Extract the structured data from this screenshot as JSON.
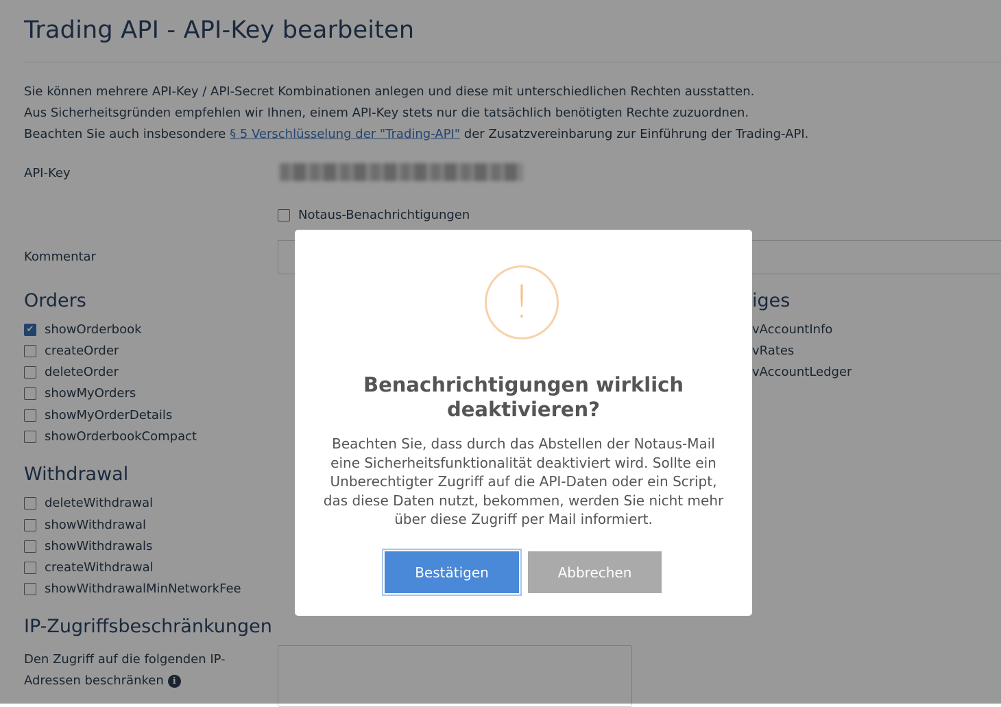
{
  "page": {
    "title": "Trading API - API-Key bearbeiten",
    "intro": {
      "line1": "Sie können mehrere API-Key / API-Secret Kombinationen anlegen und diese mit unterschiedlichen Rechten ausstatten.",
      "line2": "Aus Sicherheitsgründen empfehlen wir Ihnen, einem API-Key stets nur die tatsächlich benötigten Rechte zuzuordnen.",
      "line3_prefix": "Beachten Sie auch insbesondere ",
      "line3_link": "§ 5 Verschlüsselung der \"Trading-API\"",
      "line3_suffix": " der Zusatzvereinbarung zur Einführung der Trading-API."
    },
    "api_key_label": "API-Key",
    "notaus_label": "Notaus-Benachrichtigungen",
    "kommentar_label": "Kommentar"
  },
  "orders": {
    "heading": "Orders",
    "items": [
      {
        "label": "showOrderbook",
        "checked": true
      },
      {
        "label": "createOrder",
        "checked": false
      },
      {
        "label": "deleteOrder",
        "checked": false
      },
      {
        "label": "showMyOrders",
        "checked": false
      },
      {
        "label": "showMyOrderDetails",
        "checked": false
      },
      {
        "label": "showOrderbookCompact",
        "checked": false
      }
    ]
  },
  "withdrawal": {
    "heading": "Withdrawal",
    "items": [
      {
        "label": "deleteWithdrawal"
      },
      {
        "label": "showWithdrawal"
      },
      {
        "label": "showWithdrawals"
      },
      {
        "label": "createWithdrawal"
      },
      {
        "label": "showWithdrawalMinNetworkFee"
      }
    ]
  },
  "sonstiges": {
    "heading": "iges",
    "items": [
      {
        "label": "vAccountInfo"
      },
      {
        "label": "vRates"
      },
      {
        "label": "vAccountLedger"
      }
    ]
  },
  "ip": {
    "heading": "IP-Zugriffsbeschränkungen",
    "label_line1": "Den Zugriff auf die folgenden IP-",
    "label_line2": "Adressen beschränken"
  },
  "modal": {
    "icon": "!",
    "title_line1": "Benachrichtigungen wirklich",
    "title_line2": "deaktivieren?",
    "text_line1": "Beachten Sie, dass durch das Abstellen der Notaus-Mail",
    "text_line2": "eine Sicherheitsfunktionalität deaktiviert wird. Sollte ein",
    "text_line3": "Unberechtigter Zugriff auf die API-Daten oder ein Script,",
    "text_line4": "das diese Daten nutzt, bekommen, werden Sie nicht mehr",
    "text_line5": "über diese Zugriff per Mail informiert.",
    "confirm_label": "Bestätigen",
    "cancel_label": "Abbrechen"
  },
  "colors": {
    "accent": "#4a88d8",
    "warning": "#f5c08a",
    "heading": "#2c4566"
  }
}
